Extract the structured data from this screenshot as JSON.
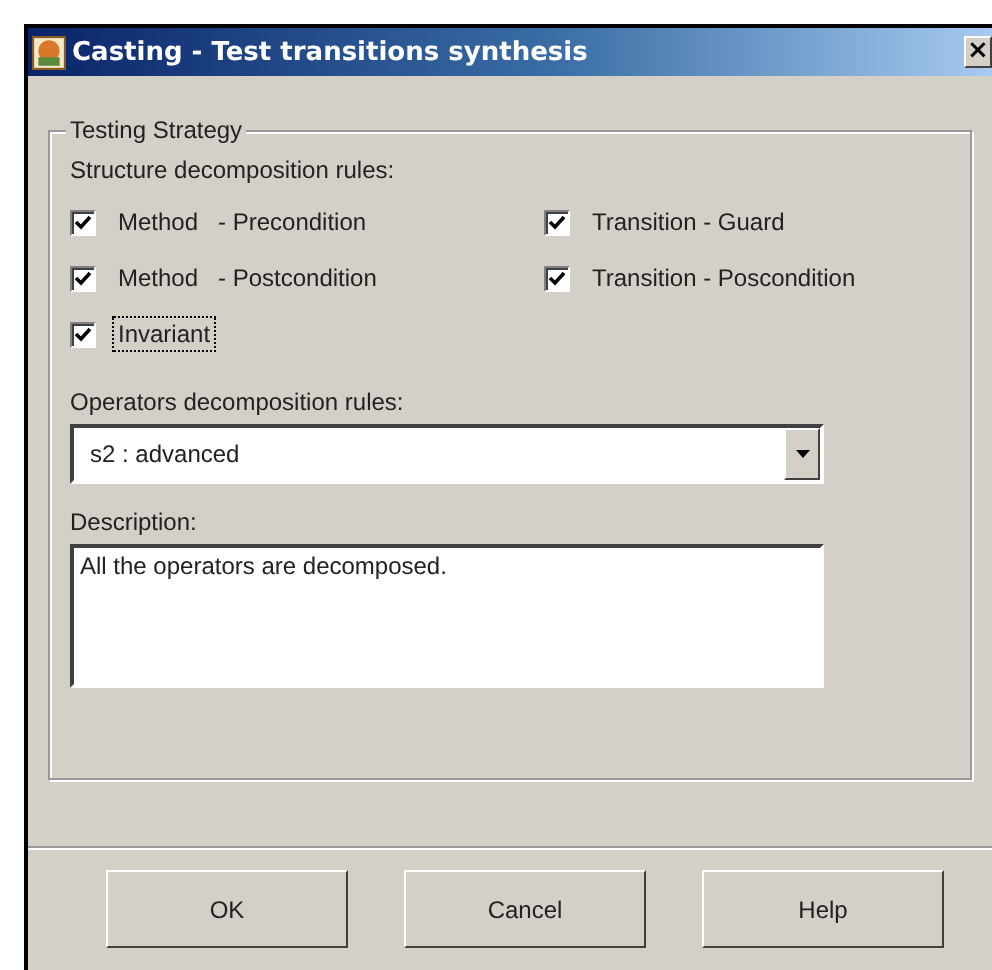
{
  "window": {
    "title": "Casting - Test transitions synthesis",
    "close": "×"
  },
  "group": {
    "title": "Testing Strategy",
    "structure_label": "Structure decomposition rules:",
    "checkboxes": [
      {
        "label": "Method   - Precondition",
        "checked": true,
        "focused": false
      },
      {
        "label": "Transition - Guard",
        "checked": true,
        "focused": false
      },
      {
        "label": "Method   - Postcondition",
        "checked": true,
        "focused": false
      },
      {
        "label": "Transition - Poscondition",
        "checked": true,
        "focused": false
      },
      {
        "label": "Invariant",
        "checked": true,
        "focused": true
      }
    ],
    "operators_label": "Operators decomposition rules:",
    "operators": {
      "value": "s2 : advanced"
    },
    "description_label": "Description:",
    "description": {
      "value": "All the operators are decomposed."
    }
  },
  "buttons": [
    {
      "label": "OK"
    },
    {
      "label": "Cancel"
    },
    {
      "label": "Help"
    }
  ]
}
